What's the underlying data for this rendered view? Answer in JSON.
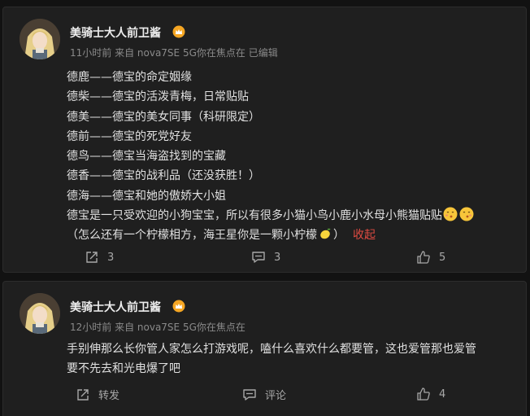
{
  "posts": [
    {
      "username": "美骑士大人前卫酱",
      "meta": "11小时前 来自 nova7SE 5G你在焦点在 已编辑",
      "lines": [
        "德鹿——德宝的命定姻缘",
        "德柴——德宝的活泼青梅，日常贴贴",
        "德美——德宝的美女同事（科研限定）",
        "德前——德宝的死党好友",
        "德鸟——德宝当海盗找到的宝藏",
        "德香——德宝的战利品（还没获胜！）",
        "德海——德宝和她的傲娇大小姐",
        "德宝是一只受欢迎的小狗宝宝，所以有很多小猫小鸟小鹿小水母小熊猫贴贴",
        "（怎么还有一个柠檬相方，海王星你是一颗小柠檬",
        "）"
      ],
      "collapse_label": "收起",
      "share_count": "3",
      "comment_count": "3",
      "like_count": "5"
    },
    {
      "username": "美骑士大人前卫酱",
      "meta": "12小时前 来自 nova7SE 5G你在焦点在",
      "lines": [
        "手别伸那么长你管人家怎么打游戏呢，嗑什么喜欢什么都要管，这也爱管那也爱管",
        "要不先去和光电爆了吧"
      ],
      "share_label": "转发",
      "comment_label": "评论",
      "like_count": "4"
    }
  ],
  "icons": {
    "badge": "crown-badge-icon",
    "share": "share-icon",
    "comment": "comment-icon",
    "like": "thumbs-up-icon",
    "kiss_emoji": "kissing-face-icon",
    "lemon_emoji": "lemon-icon"
  },
  "colors": {
    "background": "#121212",
    "card": "#1f1f1f",
    "link_red": "#e04b42",
    "badge_orange": "#f5a623"
  }
}
